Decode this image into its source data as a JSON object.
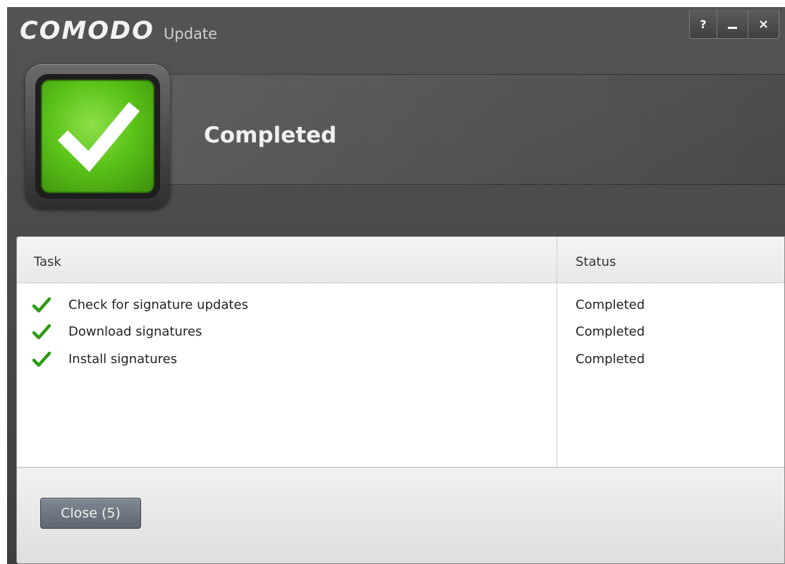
{
  "window": {
    "brand": "COMODO",
    "title": "Update",
    "controls": {
      "help_label": "?",
      "close_label": "×"
    }
  },
  "hero": {
    "status_title": "Completed",
    "status_color": "#5cc319"
  },
  "table": {
    "headers": {
      "task": "Task",
      "status": "Status"
    },
    "rows": [
      {
        "task": "Check for signature updates",
        "status": "Completed",
        "icon": "check-icon"
      },
      {
        "task": "Download signatures",
        "status": "Completed",
        "icon": "check-icon"
      },
      {
        "task": "Install signatures",
        "status": "Completed",
        "icon": "check-icon"
      }
    ]
  },
  "footer": {
    "close_button": "Close (5)"
  },
  "colors": {
    "check_green": "#2e9a12",
    "titlebar_bg": "#4a4a4a"
  }
}
